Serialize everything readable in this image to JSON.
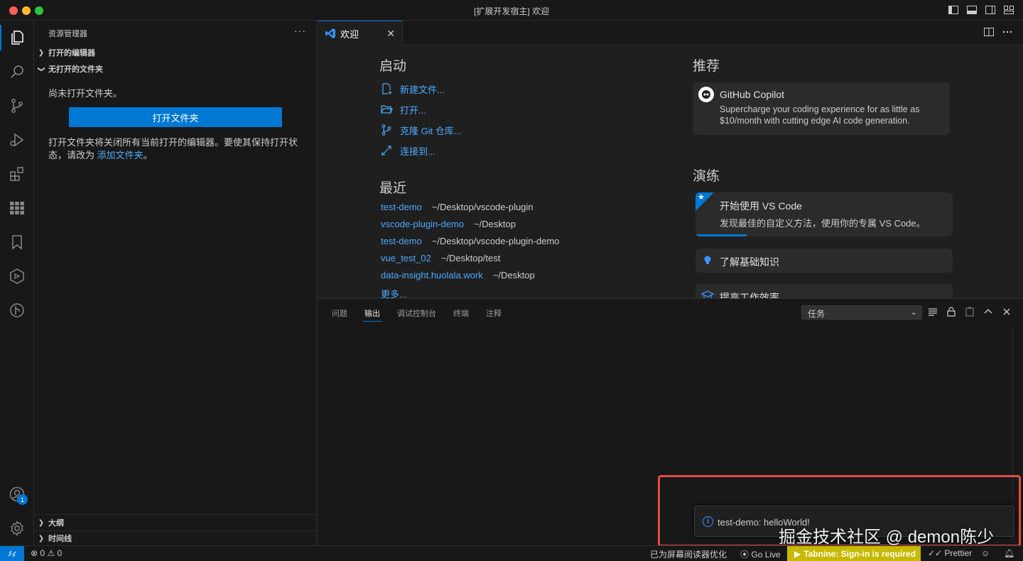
{
  "window": {
    "title": "[扩展开发宿主] 欢迎"
  },
  "sidebar": {
    "title": "资源管理器",
    "more": "···",
    "sections": {
      "open_editors": "打开的编辑器",
      "no_folder": "无打开的文件夹",
      "outline": "大纲",
      "timeline": "时间线"
    },
    "empty_text": "尚未打开文件夹。",
    "open_folder_button": "打开文件夹",
    "note_line1": "打开文件夹将关闭所有当前打开的编辑器。要使其保持打开状",
    "note_line2_prefix": "态，请改为",
    "note_link": "添加文件夹",
    "note_suffix": "。"
  },
  "activity_bar": {
    "account_badge": "1"
  },
  "tabs": [
    {
      "label": "欢迎",
      "close": "✕"
    }
  ],
  "welcome": {
    "start": {
      "heading": "启动",
      "items": [
        "新建文件...",
        "打开...",
        "克隆 Git 仓库...",
        "连接到..."
      ]
    },
    "recent": {
      "heading": "最近",
      "items": [
        {
          "name": "test-demo",
          "path": "~/Desktop/vscode-plugin"
        },
        {
          "name": "vscode-plugin-demo",
          "path": "~/Desktop"
        },
        {
          "name": "test-demo",
          "path": "~/Desktop/vscode-plugin-demo"
        },
        {
          "name": "vue_test_02",
          "path": "~/Desktop/test"
        },
        {
          "name": "data-insight.huolala.work",
          "path": "~/Desktop"
        }
      ],
      "more": "更多..."
    },
    "recommended": {
      "heading": "推荐",
      "card": {
        "title": "GitHub Copilot",
        "desc": "Supercharge your coding experience for as little as $10/month with cutting edge AI code generation."
      }
    },
    "walkthroughs": {
      "heading": "演练",
      "items": [
        {
          "title": "开始使用 VS Code",
          "desc": "发现最佳的自定义方法，使用你的专属 VS Code。"
        },
        {
          "title": "了解基础知识"
        },
        {
          "title": "提高工作效率"
        }
      ]
    }
  },
  "panel": {
    "tabs": [
      "问题",
      "输出",
      "调试控制台",
      "终端",
      "注释"
    ],
    "active_tab": "输出",
    "channel": "任务"
  },
  "notification": {
    "text": "test-demo: helloWorld!"
  },
  "watermark": "掘金技术社区 @ demon陈少",
  "statusbar": {
    "errors": "0",
    "warnings": "0",
    "screen_reader": "已为屏幕阅读器优化",
    "go_live": "Go Live",
    "tabnine": "Tabnine: Sign-in is required",
    "prettier": "Prettier"
  },
  "colors": {
    "accent": "#0078d4",
    "link": "#4daafc",
    "tabnine": "#c7b900",
    "highlight_frame": "#e14d45"
  }
}
